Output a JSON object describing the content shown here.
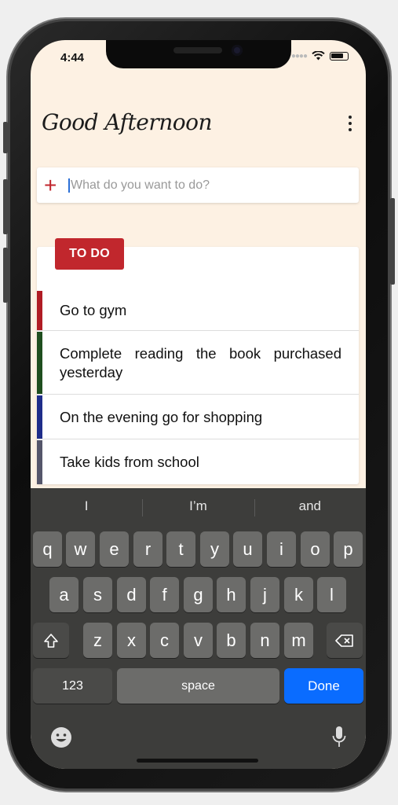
{
  "status_bar": {
    "time": "4:44",
    "signal_icon": "signal-icon",
    "wifi_icon": "wifi-icon",
    "battery_icon": "battery-icon"
  },
  "header": {
    "greeting": "Good Afternoon",
    "menu_icon": "more-vert-icon"
  },
  "add_task": {
    "placeholder": "What do you want to do?",
    "value": "",
    "add_icon": "plus-icon"
  },
  "list": {
    "badge": "TO DO",
    "tasks": [
      {
        "text": "Go to gym",
        "color": "#b01c24"
      },
      {
        "text": "Complete reading the book purchased yesterday",
        "color": "#1f4e1f"
      },
      {
        "text": "On the evening go for shopping",
        "color": "#1f2d8a"
      },
      {
        "text": "Take kids from school",
        "color": "#55566a"
      }
    ]
  },
  "keyboard": {
    "suggestions": [
      "I",
      "I’m",
      "and"
    ],
    "row1": [
      "q",
      "w",
      "e",
      "r",
      "t",
      "y",
      "u",
      "i",
      "o",
      "p"
    ],
    "row2": [
      "a",
      "s",
      "d",
      "f",
      "g",
      "h",
      "j",
      "k",
      "l"
    ],
    "row3": [
      "z",
      "x",
      "c",
      "v",
      "b",
      "n",
      "m"
    ],
    "numbers_label": "123",
    "space_label": "space",
    "done_label": "Done",
    "shift_icon": "shift-icon",
    "backspace_icon": "backspace-icon",
    "emoji_icon": "emoji-icon",
    "mic_icon": "microphone-icon"
  },
  "colors": {
    "accent": "#c1272d",
    "background": "#fdf1e3",
    "done_key": "#0a6cff"
  }
}
